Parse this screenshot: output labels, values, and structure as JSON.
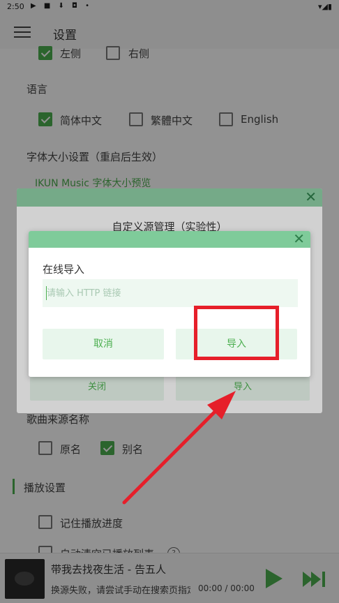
{
  "status_bar": {
    "time": "2:50",
    "icons": "▶ ■ ⬇ ◘ •",
    "right_icons": "▾◢▮"
  },
  "app_bar": {
    "title": "设置",
    "menu_icon": "hamburger-menu-icon"
  },
  "settings": {
    "position_options": [
      {
        "label": "左侧",
        "checked": true
      },
      {
        "label": "右侧",
        "checked": false
      }
    ],
    "language_label": "语言",
    "languages": [
      {
        "label": "简体中文",
        "checked": true
      },
      {
        "label": "繁體中文",
        "checked": false
      },
      {
        "label": "English",
        "checked": false
      }
    ],
    "font_size_label": "字体大小设置（重启后生效）",
    "font_preview": "IKUN Music 字体大小预览",
    "song_source_name_label": "歌曲来源名称",
    "source_name_options": [
      {
        "label": "原名",
        "checked": false
      },
      {
        "label": "别名",
        "checked": true
      }
    ],
    "playback_section": "播放设置",
    "remember_progress": {
      "label": "记住播放进度",
      "checked": false
    },
    "auto_clear": {
      "label": "自动清空已播放列表",
      "checked": false
    }
  },
  "player": {
    "song_title": "带我去找夜生活 - 告五人",
    "status": "换源失败，请尝试手动在搜索页指定...",
    "time": "00:00 / 00:00",
    "accent": "#4caf50"
  },
  "outer_dialog": {
    "title": "自定义源管理（实验性）",
    "close_label": "关闭",
    "import_label": "导入",
    "close_icon": "close-icon"
  },
  "inner_dialog": {
    "label": "在线导入",
    "input_placeholder": "请输入 HTTP 链接",
    "cancel_label": "取消",
    "import_label": "导入",
    "close_icon": "close-icon",
    "header_color": "#7fcb9a"
  },
  "annotation": {
    "highlight_color": "#e61f2a",
    "target": "inner_dialog.import"
  }
}
